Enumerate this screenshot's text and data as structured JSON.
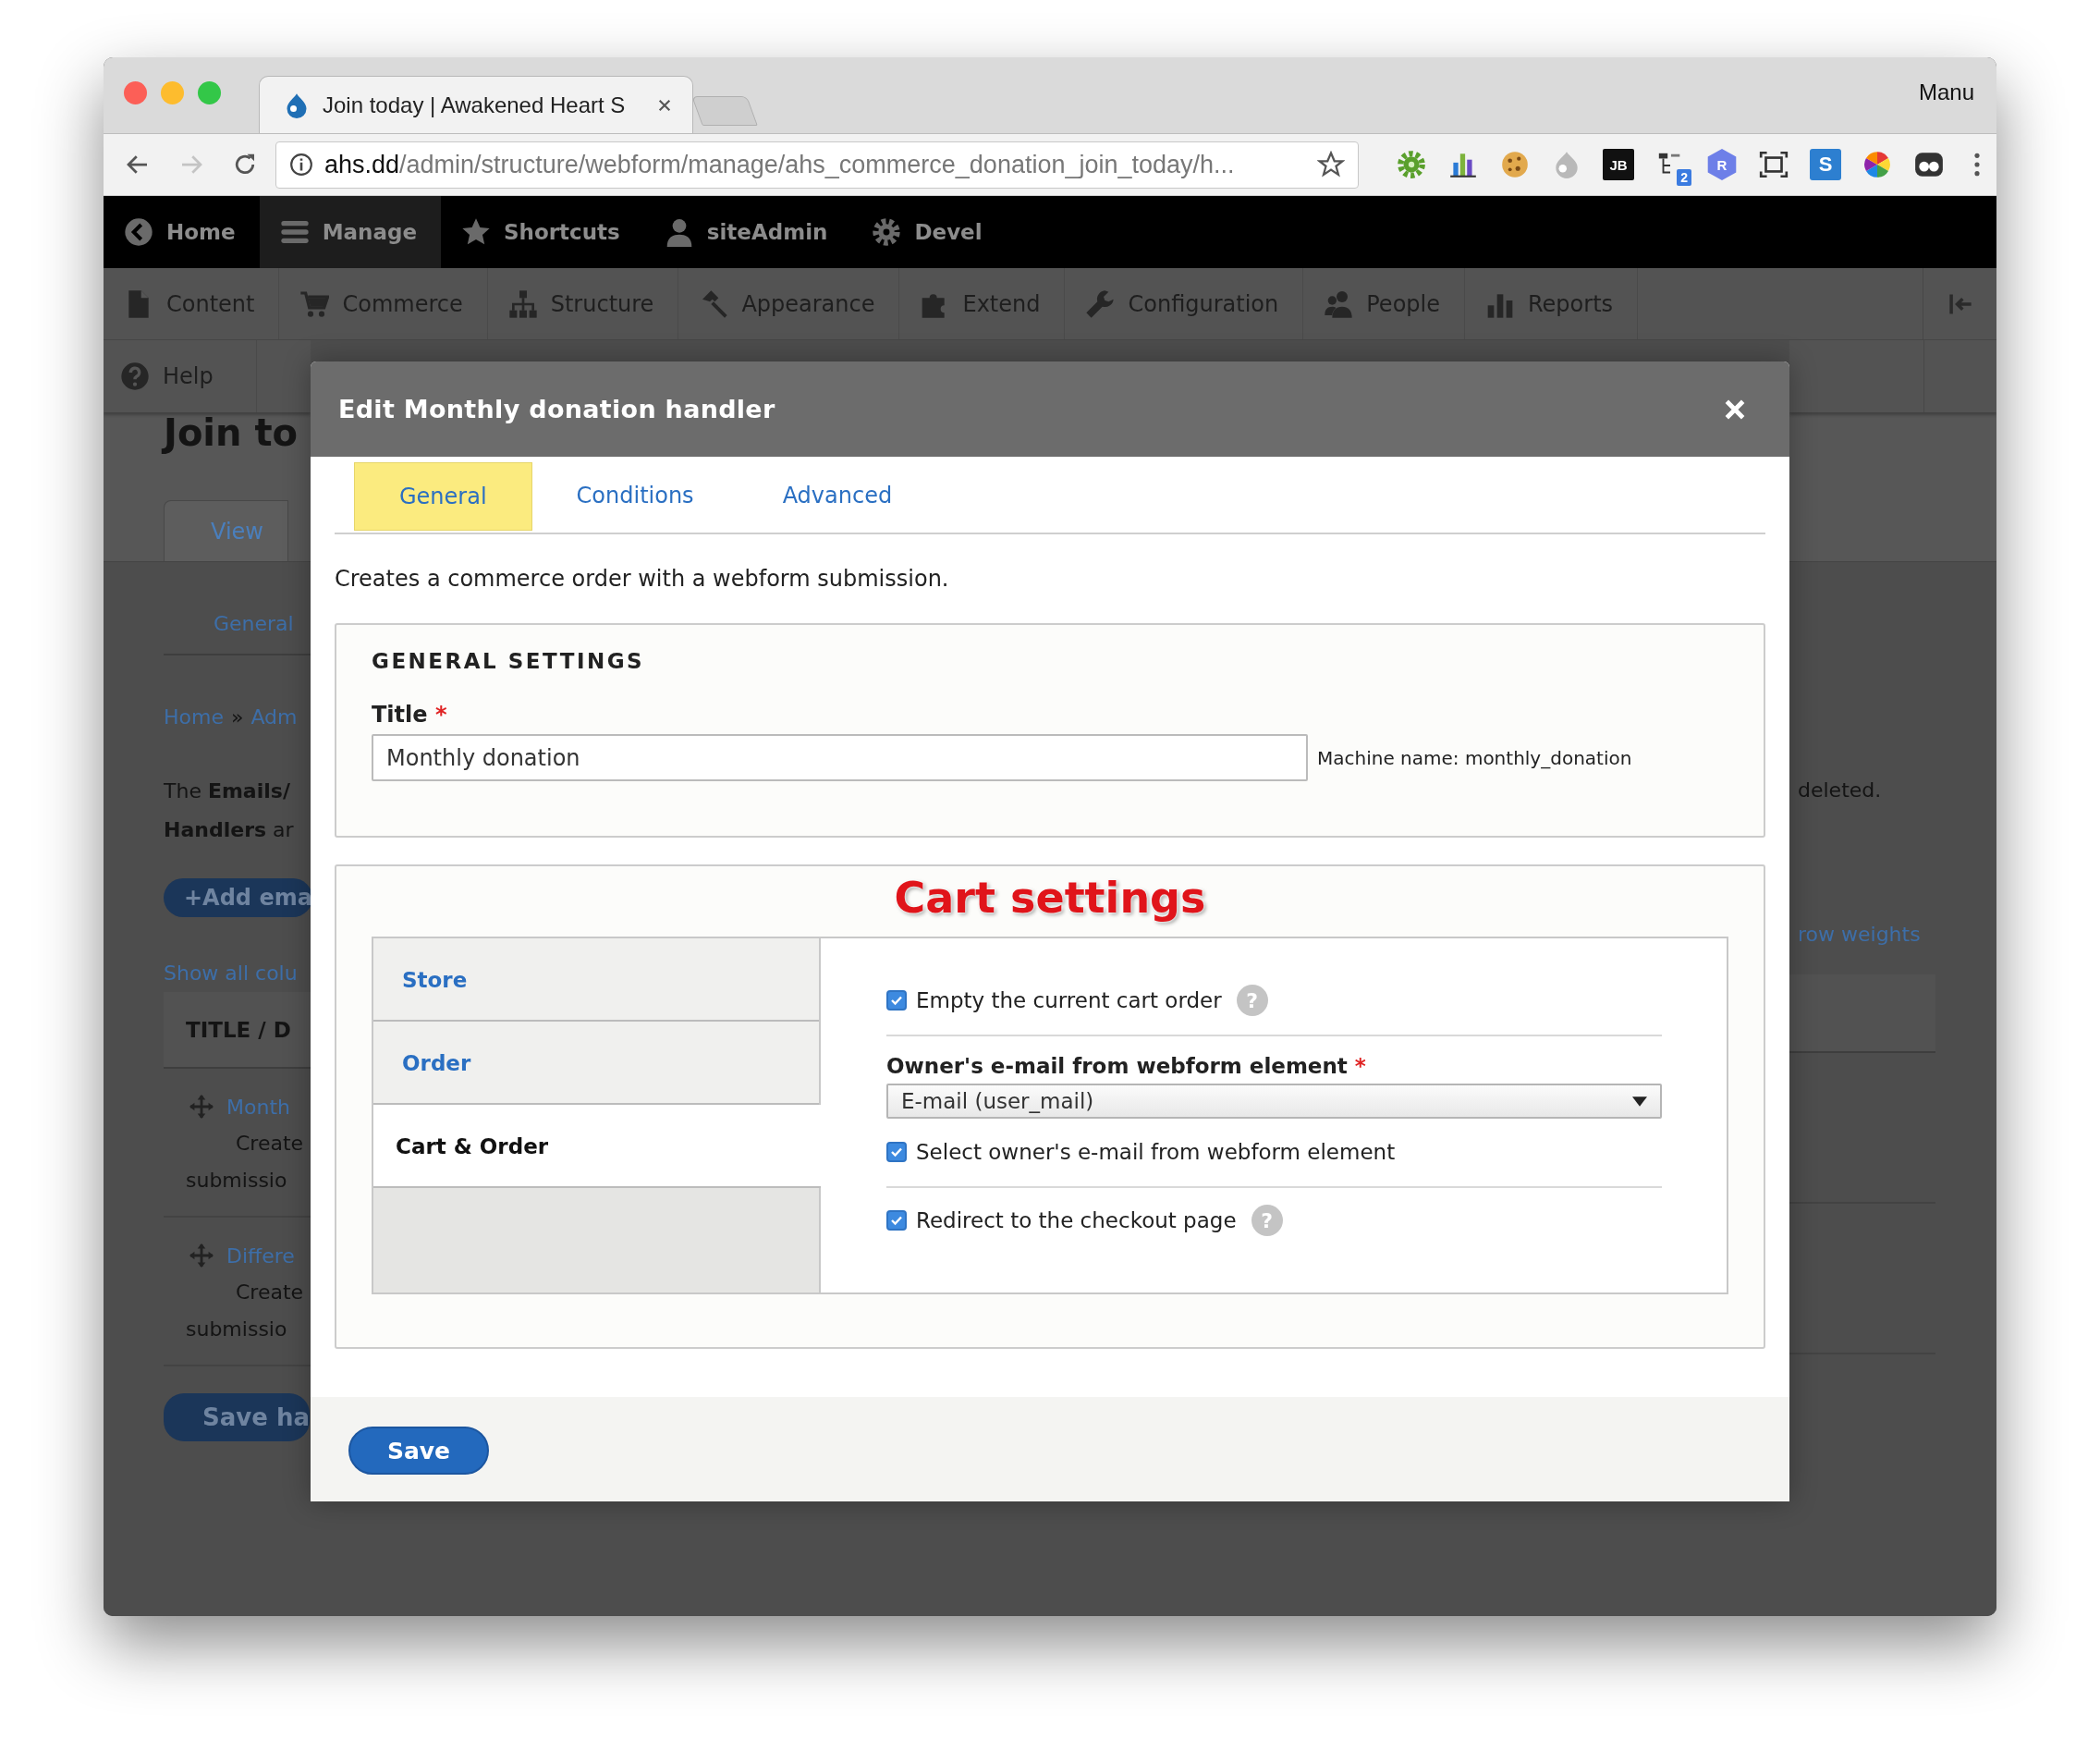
{
  "browser": {
    "tab_title": "Join today | Awakened Heart S",
    "profile": "Manu",
    "url_host": "ahs.dd",
    "url_path": "/admin/structure/webform/manage/ahs_commerce_donation_join_today/h...",
    "extensions": [
      {
        "kind": "gear"
      },
      {
        "kind": "chart"
      },
      {
        "kind": "cookie"
      },
      {
        "kind": "drop"
      },
      {
        "kind": "tile",
        "label": "JB"
      },
      {
        "kind": "tree",
        "label": "2"
      },
      {
        "kind": "hex",
        "label": "R"
      },
      {
        "kind": "frame"
      },
      {
        "kind": "blue_tile",
        "label": "S"
      },
      {
        "kind": "wheel"
      },
      {
        "kind": "glasses"
      }
    ]
  },
  "admin_bar": [
    {
      "label": "Home",
      "kind": "back",
      "selected": false
    },
    {
      "label": "Manage",
      "kind": "menu",
      "selected": true
    },
    {
      "label": "Shortcuts",
      "kind": "star",
      "selected": false
    },
    {
      "label": "siteAdmin",
      "kind": "user",
      "selected": false
    },
    {
      "label": "Devel",
      "kind": "gear",
      "selected": false
    }
  ],
  "tray": [
    {
      "label": "Content",
      "kind": "page"
    },
    {
      "label": "Commerce",
      "kind": "cart"
    },
    {
      "label": "Structure",
      "kind": "sitemap"
    },
    {
      "label": "Appearance",
      "kind": "hammer"
    },
    {
      "label": "Extend",
      "kind": "puzzle"
    },
    {
      "label": "Configuration",
      "kind": "wrench"
    },
    {
      "label": "People",
      "kind": "people"
    },
    {
      "label": "Reports",
      "kind": "chart"
    }
  ],
  "tray_row_2": [
    {
      "label": "Help",
      "kind": "help"
    }
  ],
  "page": {
    "left": {
      "title": "Join to",
      "tab": "View",
      "subtab": "General",
      "breadcrumb": [
        {
          "label": "Home"
        },
        {
          "label": "Adm"
        }
      ],
      "separator": "»",
      "intro": [
        "The **Emails/**",
        "**Handlers** ar"
      ],
      "add_button": "+Add ema",
      "show_columns": "Show all colu",
      "table_heading": "TITLE / D",
      "rows": [
        {
          "title": "Month",
          "lines": [
            "Create",
            "submissio"
          ]
        },
        {
          "title": "Differe",
          "lines": [
            "Create",
            "submissio"
          ]
        }
      ],
      "save_button": "Save ha"
    },
    "right": {
      "intro_end": "deleted.",
      "link": "row weights"
    }
  },
  "dialog": {
    "title": "Edit Monthly donation handler",
    "tabs": [
      {
        "label": "General",
        "selected": true
      },
      {
        "label": "Conditions",
        "selected": false
      },
      {
        "label": "Advanced",
        "selected": false
      }
    ],
    "description": "Creates a commerce order with a webform submission.",
    "general": {
      "legend": "GENERAL SETTINGS",
      "title_label": "Title",
      "required_mark": "*",
      "title_value": "Monthly donation",
      "machine_name": "Machine name: monthly_donation"
    },
    "cart": {
      "heading": "Cart settings",
      "vtabs": [
        {
          "label": "Store",
          "selected": false
        },
        {
          "label": "Order",
          "selected": false
        },
        {
          "label": "Cart & Order",
          "selected": true
        }
      ],
      "groups": [
        [
          {
            "kind": "checkbox",
            "label": "Empty the current cart order",
            "checked": true,
            "help": "?"
          }
        ],
        [
          {
            "kind": "select",
            "label": "Owner's e-mail from webform element",
            "required_mark": "*",
            "value": "E-mail (user_mail)"
          },
          {
            "kind": "checkbox",
            "label": "Select owner's e-mail from webform element",
            "checked": true
          }
        ],
        [
          {
            "kind": "checkbox",
            "label": "Redirect to the checkout page",
            "checked": true,
            "help": "?"
          }
        ]
      ]
    },
    "save": "Save"
  }
}
